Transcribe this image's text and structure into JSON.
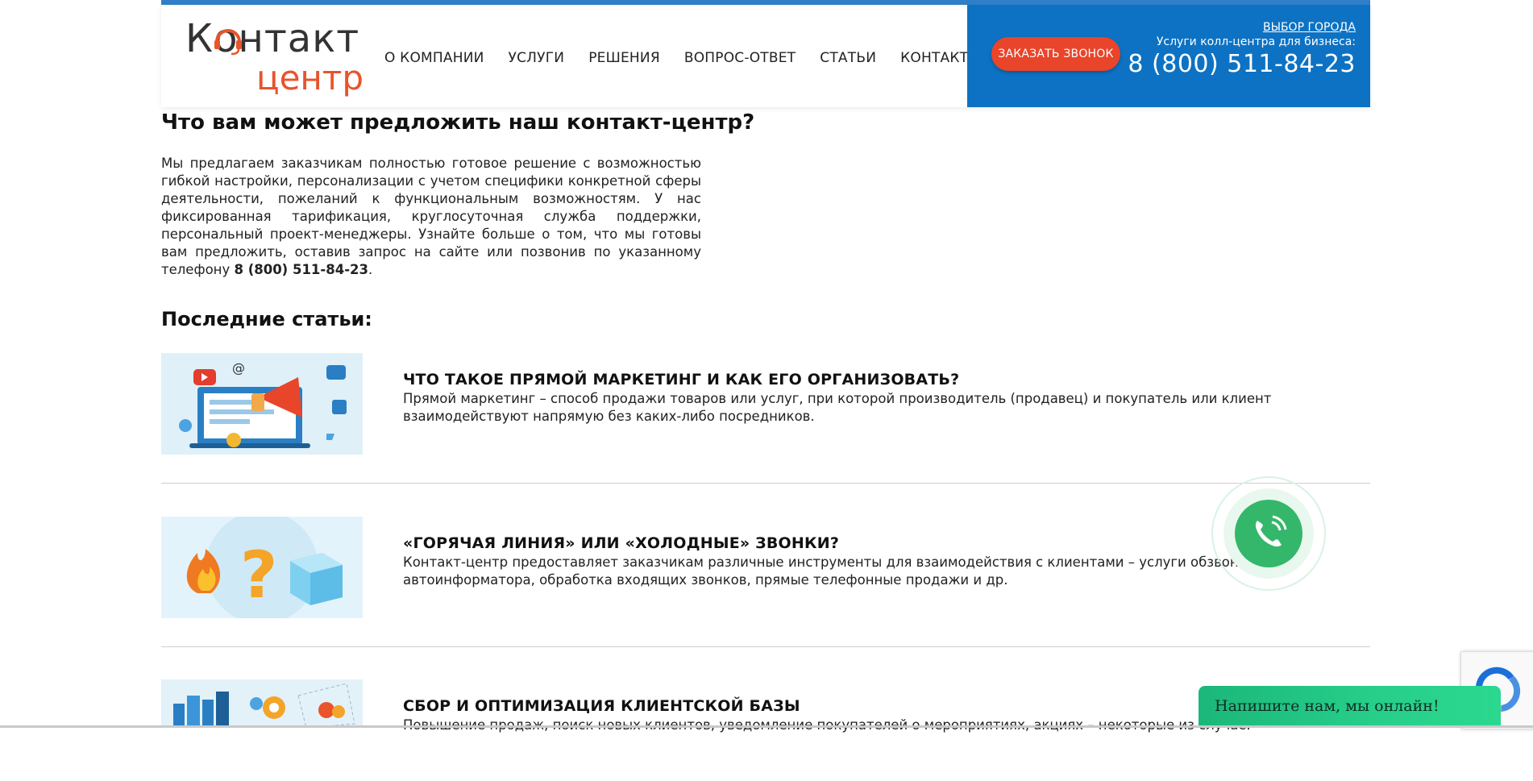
{
  "header": {
    "logo_line1": "Контакт",
    "logo_line2": "центр",
    "nav": [
      {
        "label": "О КОМПАНИИ"
      },
      {
        "label": "УСЛУГИ"
      },
      {
        "label": "РЕШЕНИЯ"
      },
      {
        "label": "ВОПРОС-ОТВЕТ"
      },
      {
        "label": "СТАТЬИ"
      },
      {
        "label": "КОНТАКТЫ"
      }
    ],
    "callback_button": "ЗАКАЗАТЬ ЗВОНОК",
    "city_link": "ВЫБОР ГОРОДА",
    "tagline": "Услуги колл-центра для бизнеса:",
    "phone": "8 (800) 511-84-23",
    "accent_color": "#e8452a",
    "blue_color": "#0d72c3"
  },
  "main": {
    "offer_heading": "Что вам может предложить наш контакт-центр?",
    "offer_text": "Мы предлагаем заказчикам полностью готовое решение с возможностью гибкой настройки, персонализации с учетом специфики конкретной сферы деятельности, пожеланий к функциональным возможностям. У нас фиксированная тарификация, круглосуточная служба поддержки, персональный проект-менеджеры. Узнайте больше о том, что мы готовы вам предложить, оставив запрос на сайте или позвонив по указанному телефону",
    "offer_phone": "8 (800) 511-84-23",
    "offer_end": ".",
    "articles_heading": "Последние статьи:",
    "articles": [
      {
        "title": "ЧТО ТАКОЕ ПРЯМОЙ МАРКЕТИНГ И КАК ЕГО ОРГАНИЗОВАТЬ?",
        "text": "Прямой маркетинг – способ продажи товаров или услуг, при которой производитель (продавец) и покупатель или клиент взаимодействуют напрямую без каких-либо посредников.",
        "image_icon": "marketing-megaphone-icon"
      },
      {
        "title": "«ГОРЯЧАЯ ЛИНИЯ» ИЛИ «ХОЛОДНЫЕ» ЗВОНКИ?",
        "text": "Контакт-центр предоставляет заказчикам различные инструменты для взаимодействия с клиентами – услуги обзвона, автоинформатора, обработка входящих звонков, прямые телефонные продажи и др.",
        "image_icon": "fire-question-ice-icon"
      },
      {
        "title": "СБОР И ОПТИМИЗАЦИЯ КЛИЕНТСКОЙ БАЗЫ",
        "text": "Повышение продаж, поиск новых клиентов, уведомление покупателей о мероприятиях, акциях – некоторые из случаев",
        "image_icon": "client-base-icon"
      }
    ]
  },
  "widgets": {
    "chat_label": "Напишите нам, мы онлайн!",
    "call_widget_icon": "phone-icon",
    "recaptcha_icon": "recaptcha-icon",
    "chat_color": "#27cf8a"
  }
}
